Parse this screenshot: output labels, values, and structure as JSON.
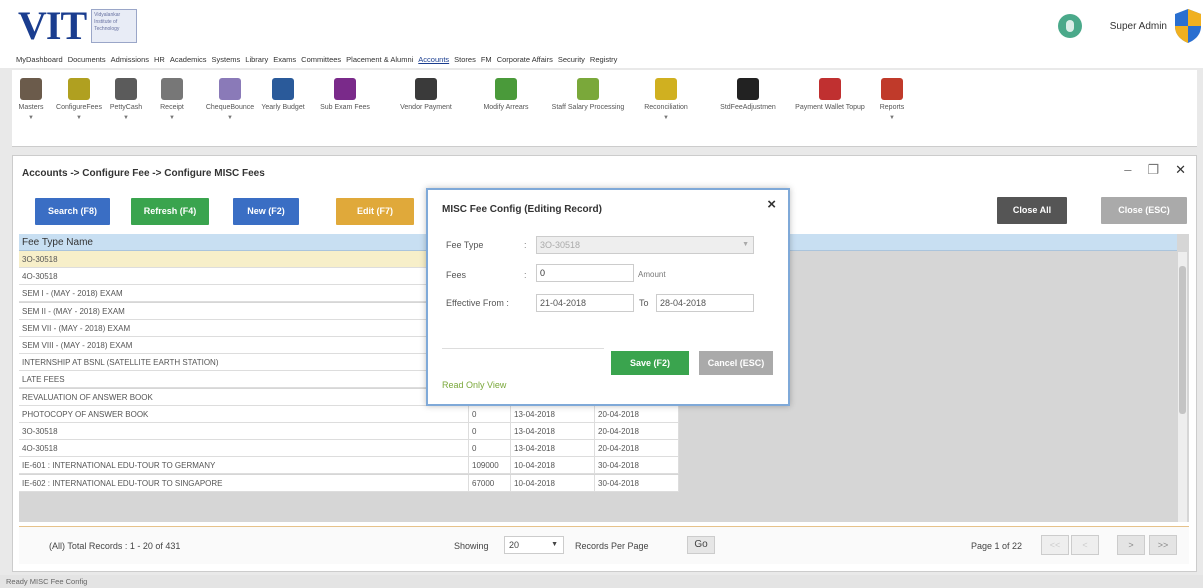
{
  "header": {
    "logo_text": "VIT",
    "logo_sub": "Vidyalankar Institute of Technology",
    "user_name": "Super Admin"
  },
  "menubar": {
    "items": [
      "MyDashboard",
      "Documents",
      "Admissions",
      "HR",
      "Academics",
      "Systems",
      "Library",
      "Exams",
      "Committees",
      "Placement & Alumni",
      "Accounts",
      "Stores",
      "FM",
      "Corporate Affairs",
      "Security",
      "Registry"
    ],
    "active": "Accounts"
  },
  "toolbar": {
    "items": [
      {
        "label": "Masters",
        "icon": "masters-icon",
        "has_arrow": true
      },
      {
        "label": "ConfigureFees",
        "icon": "configure-fees-icon",
        "has_arrow": true
      },
      {
        "label": "PettyCash",
        "icon": "petty-cash-icon",
        "has_arrow": true
      },
      {
        "label": "Receipt",
        "icon": "receipt-icon",
        "has_arrow": true
      },
      {
        "label": "ChequeBounce",
        "icon": "cheque-bounce-icon",
        "has_arrow": true
      },
      {
        "label": "Yearly Budget",
        "icon": "yearly-budget-icon",
        "has_arrow": false
      },
      {
        "label": "Sub Exam Fees",
        "icon": "sub-exam-fees-icon",
        "has_arrow": false
      },
      {
        "label": "Vendor Payment",
        "icon": "vendor-payment-icon",
        "has_arrow": false
      },
      {
        "label": "Modify Arrears",
        "icon": "modify-arrears-icon",
        "has_arrow": false
      },
      {
        "label": "Staff Salary Processing",
        "icon": "staff-salary-icon",
        "has_arrow": false
      },
      {
        "label": "Reconciliation",
        "icon": "reconciliation-icon",
        "has_arrow": true
      },
      {
        "label": "StdFeeAdjustmen",
        "icon": "fee-adjustment-icon",
        "has_arrow": false
      },
      {
        "label": "Payment Wallet Topup",
        "icon": "wallet-topup-icon",
        "has_arrow": false
      },
      {
        "label": "Reports",
        "icon": "reports-icon",
        "has_arrow": true
      }
    ]
  },
  "panel": {
    "breadcrumb": "Accounts -> Configure Fee -> Configure MISC Fees",
    "buttons": {
      "search": "Search (F8)",
      "refresh": "Refresh (F4)",
      "new": "New (F2)",
      "edit": "Edit (F7)",
      "close_all": "Close All",
      "close": "Close (ESC)"
    }
  },
  "grid": {
    "header": "Fee Type Name",
    "rows": [
      {
        "name": "3O-30518",
        "fees": "",
        "from": "",
        "to": "",
        "selected": true
      },
      {
        "name": "4O-30518",
        "fees": "",
        "from": "",
        "to": ""
      },
      {
        "name": "SEM I - (MAY - 2018) EXAM",
        "fees": "",
        "from": "",
        "to": ""
      },
      {
        "name": "SEM II - (MAY - 2018) EXAM",
        "fees": "",
        "from": "",
        "to": ""
      },
      {
        "name": "SEM VII - (MAY - 2018) EXAM",
        "fees": "",
        "from": "",
        "to": ""
      },
      {
        "name": "SEM VIII - (MAY - 2018) EXAM",
        "fees": "",
        "from": "",
        "to": ""
      },
      {
        "name": "INTERNSHIP AT BSNL (SATELLITE EARTH STATION)",
        "fees": "",
        "from": "",
        "to": ""
      },
      {
        "name": "LATE FEES",
        "fees": "",
        "from": "",
        "to": ""
      },
      {
        "name": "REVALUATION OF ANSWER BOOK",
        "fees": "0",
        "from": "13-04-2018",
        "to": "20-04-2018"
      },
      {
        "name": "PHOTOCOPY OF ANSWER BOOK",
        "fees": "0",
        "from": "13-04-2018",
        "to": "20-04-2018"
      },
      {
        "name": "3O-30518",
        "fees": "0",
        "from": "13-04-2018",
        "to": "20-04-2018"
      },
      {
        "name": "4O-30518",
        "fees": "0",
        "from": "13-04-2018",
        "to": "20-04-2018"
      },
      {
        "name": "IE-601 : INTERNATIONAL EDU-TOUR TO GERMANY",
        "fees": "109000",
        "from": "10-04-2018",
        "to": "30-04-2018"
      },
      {
        "name": "IE-602 : INTERNATIONAL EDU-TOUR TO SINGAPORE",
        "fees": "67000",
        "from": "10-04-2018",
        "to": "30-04-2018"
      }
    ]
  },
  "footer": {
    "total_records": "(All) Total Records : 1 - 20 of 431",
    "showing": "Showing",
    "per_page_value": "20",
    "per_page_label": "Records Per Page",
    "go": "Go",
    "page_info": "Page 1 of 22",
    "first": "<<",
    "prev": "<",
    "next": ">",
    "last": ">>"
  },
  "statusbar": {
    "text": "Ready  MISC Fee Config"
  },
  "modal": {
    "title": "MISC Fee Config (Editing Record)",
    "close": "×",
    "fee_type_label": "Fee Type",
    "fee_type_value": "3O-30518",
    "fees_label": "Fees",
    "fees_value": "0",
    "amount_label": "Amount",
    "effective_from_label": "Effective From :",
    "effective_from_value": "21-04-2018",
    "to_label": "To",
    "to_value": "28-04-2018",
    "save": "Save (F2)",
    "cancel": "Cancel (ESC)",
    "readonly": "Read Only View"
  },
  "colors": {
    "primary_blue": "#3a6ec4",
    "green": "#3aa44e",
    "orange": "#e0a93a",
    "dark": "#555555",
    "selected_row": "#f7efc9",
    "header_row": "#c8dff2"
  }
}
